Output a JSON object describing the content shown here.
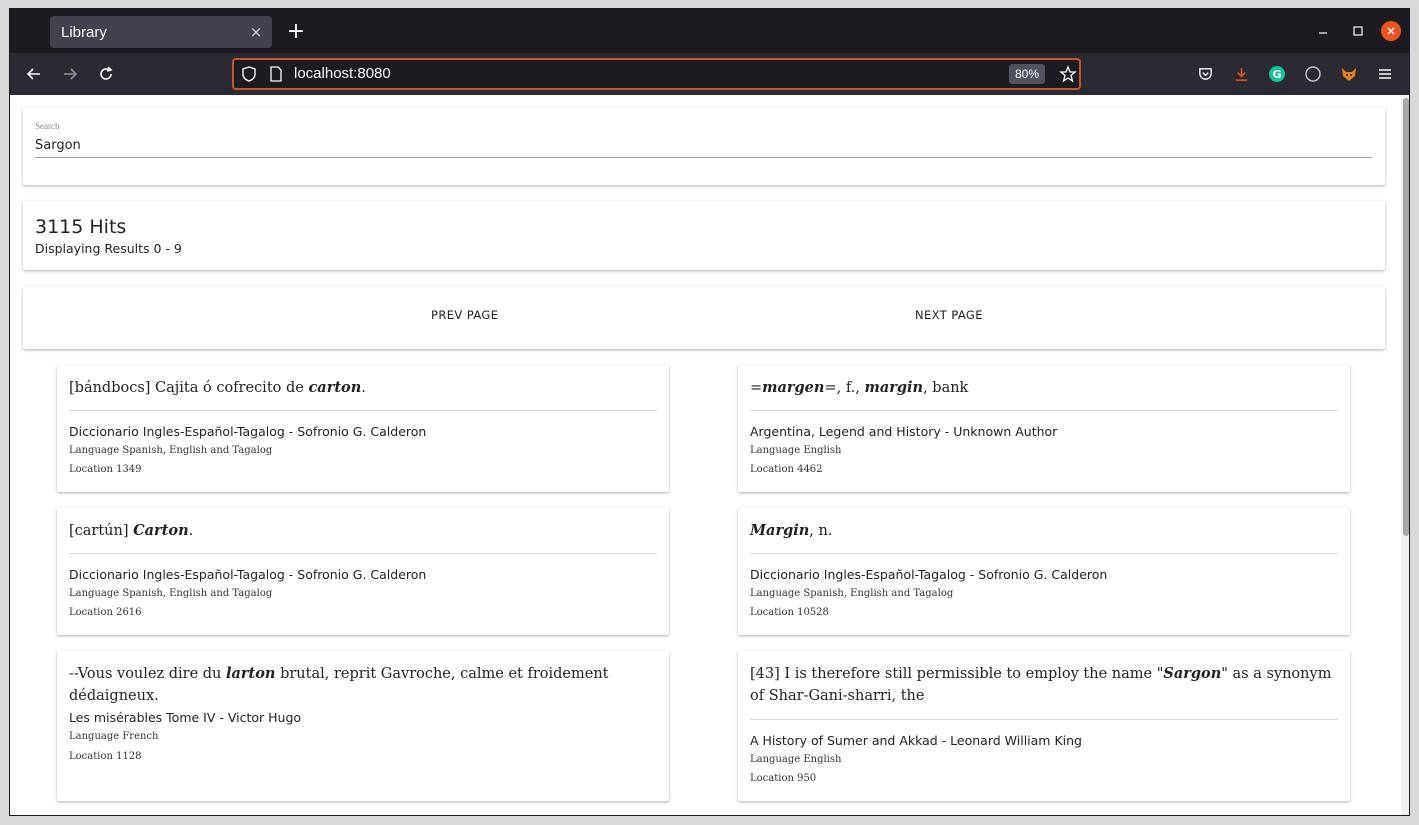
{
  "browser": {
    "tab_title": "Library",
    "tab_close": "×",
    "new_tab": "+",
    "url": "localhost:8080",
    "zoom": "80%"
  },
  "search": {
    "label": "Search",
    "value": "Sargon"
  },
  "hits": {
    "count": "3115 Hits",
    "range": "Displaying Results 0 - 9"
  },
  "pager": {
    "prev": "PREV PAGE",
    "next": "NEXT PAGE"
  },
  "results": [
    {
      "pre": "[bándbocs] Cajita ó cofrecito de ",
      "em": "carton",
      "post": ".",
      "title": "Diccionario Ingles-Español-Tagalog - Sofronio G. Calderon",
      "language": "Language Spanish, English and Tagalog",
      "location": "Location 1349"
    },
    {
      "pre": "=",
      "em": "margen",
      "post": "=, f., ",
      "em2": "margin",
      "post2": ", bank",
      "title": "Argentina, Legend and History - Unknown Author",
      "language": "Language English",
      "location": "Location 4462"
    },
    {
      "pre": "[cartún] ",
      "em": "Carton",
      "post": ".",
      "title": "Diccionario Ingles-Español-Tagalog - Sofronio G. Calderon",
      "language": "Language Spanish, English and Tagalog",
      "location": "Location 2616"
    },
    {
      "pre": "",
      "em": "Margin",
      "post": ", n.",
      "title": "Diccionario Ingles-Español-Tagalog - Sofronio G. Calderon",
      "language": "Language Spanish, English and Tagalog",
      "location": "Location 10528"
    },
    {
      "pre": "--Vous voulez dire du ",
      "em": "larton",
      "post": " brutal, reprit Gavroche, calme et froidement dédaigneux.",
      "title": "Les misérables Tome IV - Victor Hugo",
      "language": "Language French",
      "location": "Location 1128"
    },
    {
      "pre": "[43] I is therefore still permissible to employ the name \"",
      "em": "Sargon",
      "post": "\" as a synonym of Shar-Gani-sharri, the",
      "title": "A History of Sumer and Akkad - Leonard William King",
      "language": "Language English",
      "location": "Location 950"
    }
  ],
  "icons": {
    "back": "arrow-left-icon",
    "forward": "arrow-right-icon",
    "reload": "reload-icon",
    "shield": "shield-icon",
    "page": "page-icon",
    "star": "star-icon",
    "pocket": "pocket-icon",
    "download": "download-icon",
    "grammarly": "grammarly-icon",
    "circle": "circle-icon",
    "fox": "fox-icon",
    "menu": "menu-icon"
  },
  "colors": {
    "accent": "#e95420",
    "url_border": "#c0582b",
    "grammarly": "#15c39a"
  }
}
